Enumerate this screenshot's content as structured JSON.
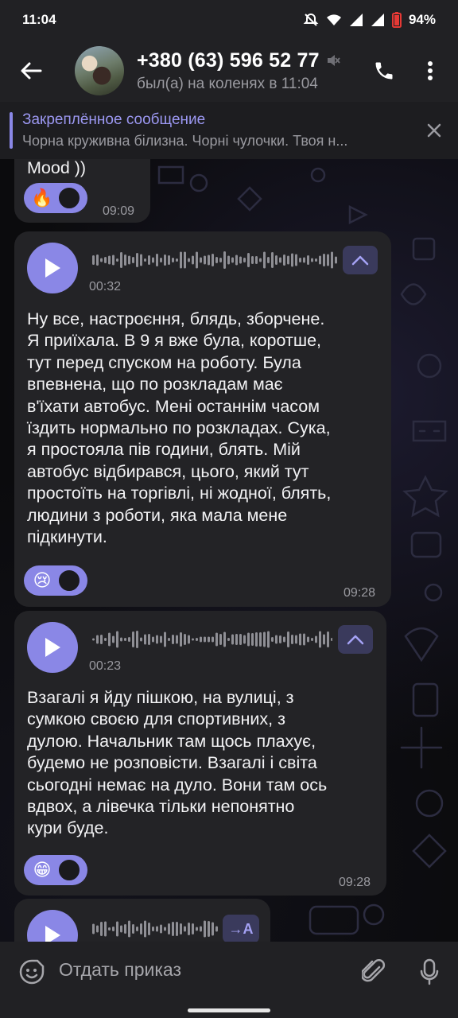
{
  "status_bar": {
    "time": "11:04",
    "battery": "94%"
  },
  "header": {
    "title": "+380 (63) 596 52 77",
    "subtitle": "был(а) на коленях в 11:04"
  },
  "pinned": {
    "title": "Закреплённое сообщение",
    "text": "Чорна круживна білизна. Чорні чулочки.  Твоя н..."
  },
  "messages": [
    {
      "text": "Mood ))",
      "reaction": "🔥",
      "time": "09:09"
    },
    {
      "duration": "00:32",
      "lines": [
        "Ну все, настроєння, блядь, зборчене.",
        "Я приїхала. В 9 я вже була, коротше,",
        "тут перед спуском на роботу. Була",
        "впевнена, що по розкладам має",
        "в'їхати автобус. Мені останнім часом",
        "їздить нормально по розкладах. Сука,",
        "я простояла пів години, блять. Мій",
        "автобус відбирався, цього, який тут",
        "простоїть на торгівлі, ні жодної, блять,",
        "людини з роботи, яка мала мене",
        "підкинути."
      ],
      "reaction": "😢",
      "time": "09:28"
    },
    {
      "duration": "00:23",
      "lines": [
        "Взагалі я йду пішкою, на вулиці, з",
        "сумкою своєю для спортивних, з",
        "дулою. Начальник там щось плахує,",
        "будемо не розповісти. Взагалі і світа",
        "сьогодні немає на дуло. Вони там ось",
        "вдвох, а лівечка тільки непонятно",
        "кури буде."
      ],
      "reaction": "😁",
      "time": "09:28"
    },
    {
      "transcribe_label": "→A"
    }
  ],
  "input": {
    "placeholder": "Отдать приказ"
  },
  "colors": {
    "accent": "#8a87e6",
    "bubble": "#232326",
    "bar": "#212124"
  }
}
